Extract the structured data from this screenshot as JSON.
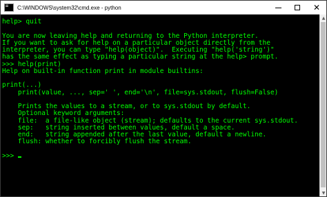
{
  "window": {
    "title": "C:\\WINDOWS\\system32\\cmd.exe - python",
    "controls": {
      "minimize": "minimize",
      "maximize": "maximize",
      "close": "✕"
    }
  },
  "colors": {
    "background": "#000000",
    "foreground": "#00ff00"
  },
  "console": {
    "lines": [
      "help> quit",
      "",
      "You are now leaving help and returning to the Python interpreter.",
      "If you want to ask for help on a particular object directly from the",
      "interpreter, you can type \"help(object)\".  Executing \"help('string')\"",
      "has the same effect as typing a particular string at the help> prompt.",
      ">>> help(print)",
      "Help on built-in function print in module builtins:",
      "",
      "print(...)",
      "    print(value, ..., sep=' ', end='\\n', file=sys.stdout, flush=False)",
      "",
      "    Prints the values to a stream, or to sys.stdout by default.",
      "    Optional keyword arguments:",
      "    file:  a file-like object (stream); defaults to the current sys.stdout.",
      "    sep:   string inserted between values, default a space.",
      "    end:   string appended after the last value, default a newline.",
      "    flush: whether to forcibly flush the stream.",
      "",
      ">>>"
    ]
  }
}
